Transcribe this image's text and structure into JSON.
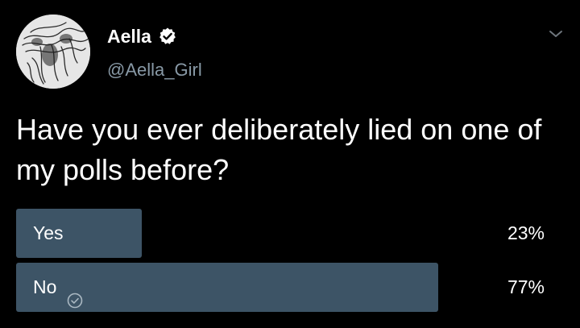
{
  "tweet": {
    "author": {
      "display_name": "Aella",
      "handle": "@Aella_Girl",
      "verified": true,
      "avatar_icon": "avatar-sketch"
    },
    "more_icon": "chevron-down-icon",
    "text": "Have you ever deliberately lied on one of my polls before?"
  },
  "poll": {
    "options": [
      {
        "label": "Yes",
        "percent_text": "23%",
        "percent": 23,
        "selected": false
      },
      {
        "label": "No",
        "percent_text": "77%",
        "percent": 77,
        "selected": true
      }
    ]
  },
  "colors": {
    "background": "#000000",
    "bar": "#3d5466",
    "secondary_text": "#8899a6",
    "verified_badge": "#ffffff"
  }
}
